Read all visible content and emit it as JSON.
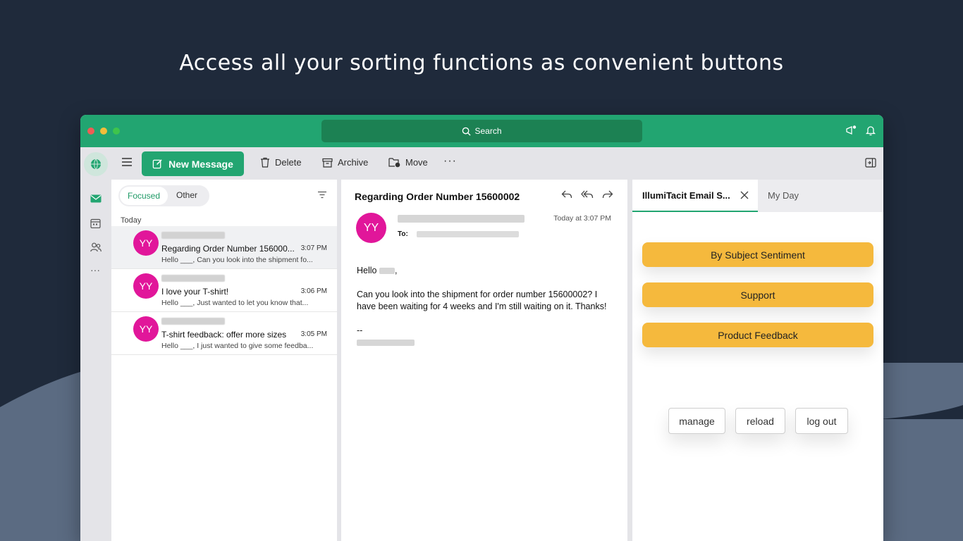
{
  "headline": "Access all your sorting functions as convenient buttons",
  "colors": {
    "brand_green": "#22a571",
    "search_green": "#1c8153",
    "avatar_pink": "#e1169a",
    "sort_button": "#f5b93d",
    "background": "#1f2a3b"
  },
  "titlebar": {
    "search_label": "Search"
  },
  "toolbar": {
    "new_message": "New Message",
    "delete": "Delete",
    "archive": "Archive",
    "move": "Move",
    "more": "···"
  },
  "list": {
    "focused": "Focused",
    "other": "Other",
    "section": "Today",
    "messages": [
      {
        "initials": "YY",
        "subject": "Regarding Order Number 156000...",
        "time": "3:07 PM",
        "preview": "Hello ___, Can you look into the shipment fo..."
      },
      {
        "initials": "YY",
        "subject": "I love your T-shirt!",
        "time": "3:06 PM",
        "preview": "Hello ___, Just wanted to let you know that..."
      },
      {
        "initials": "YY",
        "subject": "T-shirt feedback: offer more sizes",
        "time": "3:05 PM",
        "preview": "Hello ___, I just wanted to give some feedba..."
      }
    ]
  },
  "reading": {
    "subject": "Regarding Order Number 15600002",
    "initials": "YY",
    "to_label": "To:",
    "time": "Today at 3:07 PM",
    "greeting": "Hello",
    "body": "Can you look into the shipment for order number 15600002? I have been waiting for 4 weeks and I'm still waiting on it. Thanks!",
    "signoff": "--"
  },
  "addin": {
    "tab_title": "IllumiTacit Email S...",
    "tab_myday": "My Day",
    "sort_buttons": [
      "By Subject Sentiment",
      "Support",
      "Product Feedback"
    ],
    "manage": "manage",
    "reload": "reload",
    "logout": "log out"
  }
}
